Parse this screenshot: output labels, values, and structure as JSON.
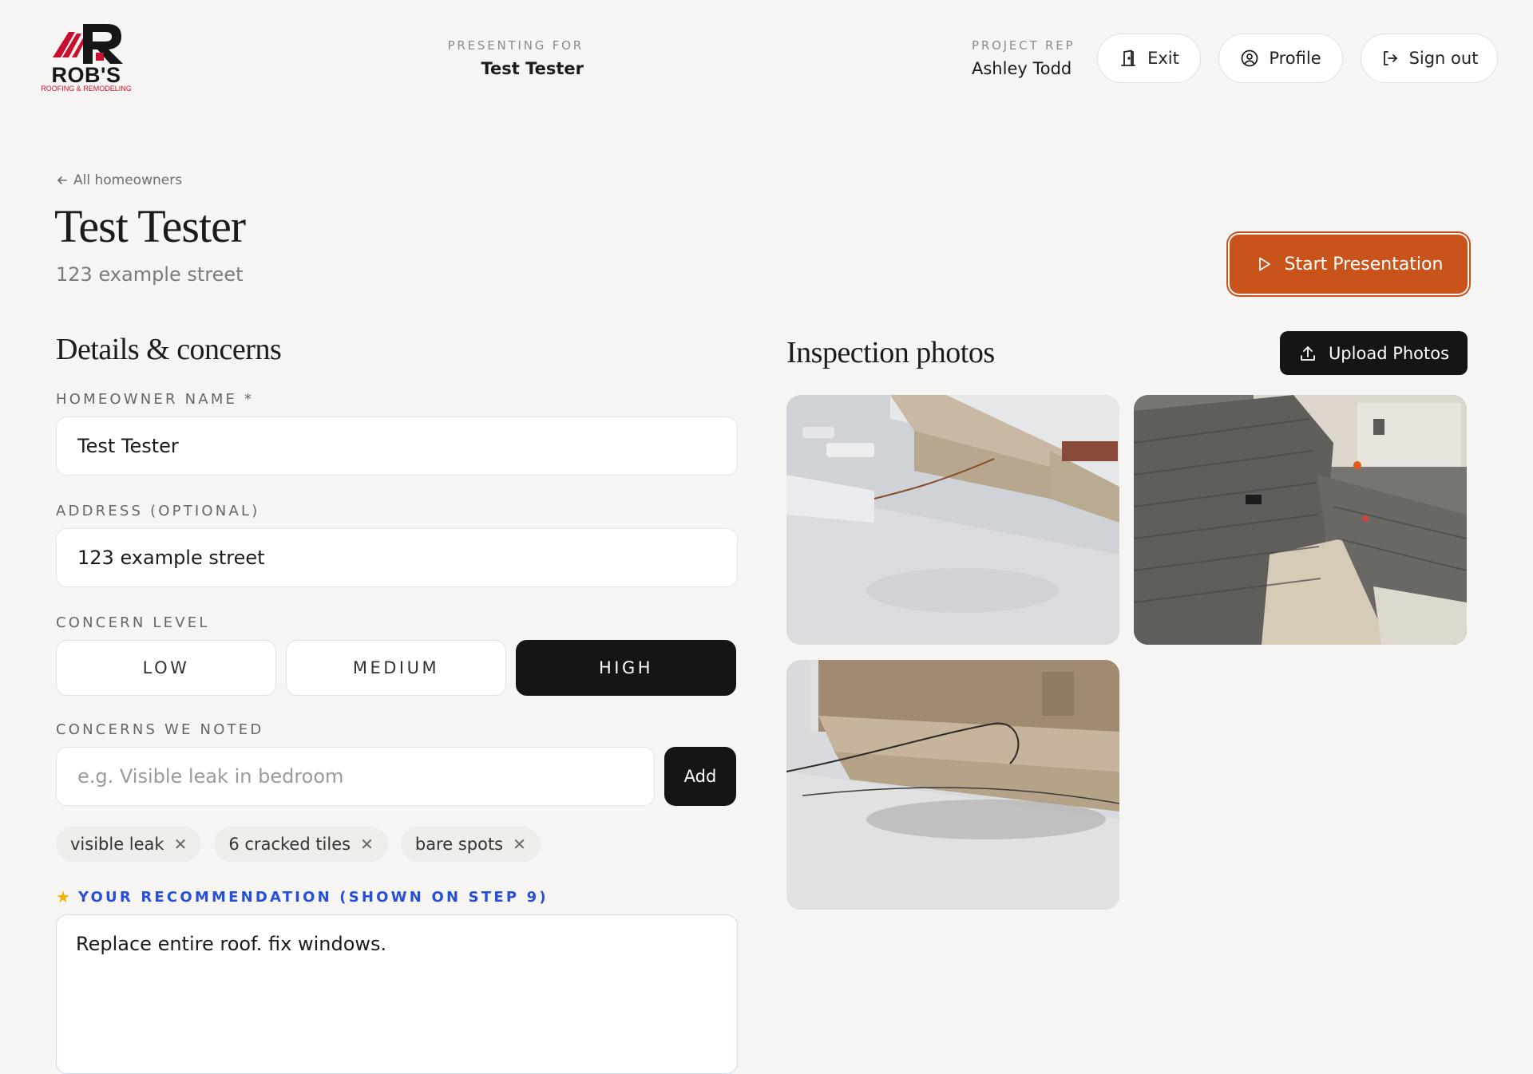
{
  "brand": {
    "name": "ROB'S",
    "tagline": "ROOFING & REMODELING",
    "colors": {
      "accent": "#c9541b",
      "brand_red": "#c8102e",
      "dark": "#151515",
      "recommendation_blue": "#2650d9"
    }
  },
  "header": {
    "presenting_for_label": "PRESENTING FOR",
    "presenting_for_value": "Test Tester",
    "project_rep_label": "PROJECT REP",
    "project_rep_value": "Ashley Todd",
    "exit_label": "Exit",
    "profile_label": "Profile",
    "signout_label": "Sign out"
  },
  "page": {
    "back_label": "All homeowners",
    "title": "Test Tester",
    "address": "123 example street",
    "start_presentation_label": "Start Presentation"
  },
  "details": {
    "section_title": "Details & concerns",
    "homeowner_name_label": "HOMEOWNER NAME *",
    "homeowner_name_value": "Test Tester",
    "address_label": "ADDRESS (OPTIONAL)",
    "address_value": "123 example street",
    "concern_level_label": "CONCERN LEVEL",
    "concern_levels": [
      "LOW",
      "MEDIUM",
      "HIGH"
    ],
    "concern_level_selected": "HIGH",
    "concerns_label": "CONCERNS WE NOTED",
    "concern_input_placeholder": "e.g. Visible leak in bedroom",
    "add_label": "Add",
    "concerns": [
      "visible leak",
      "6 cracked tiles",
      "bare spots"
    ],
    "recommendation_label": "YOUR RECOMMENDATION (SHOWN ON STEP 9)",
    "recommendation_value": "Replace entire roof. fix windows."
  },
  "photos": {
    "section_title": "Inspection photos",
    "upload_label": "Upload Photos",
    "count": 3
  }
}
